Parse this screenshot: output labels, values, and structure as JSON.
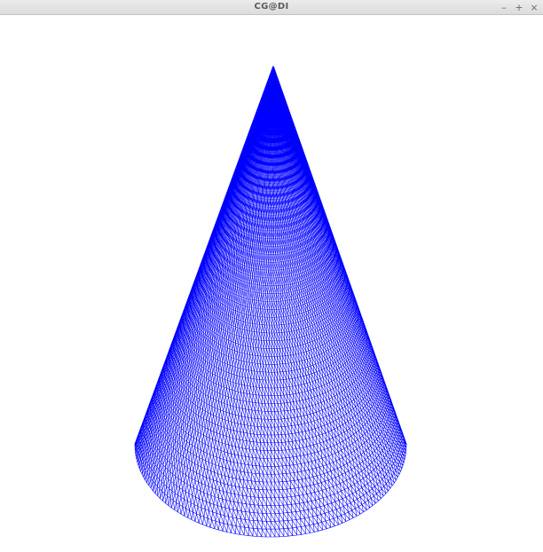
{
  "window": {
    "title": "CG@DI",
    "controls": {
      "minimize_label": "–",
      "maximize_label": "+",
      "close_label": "×"
    }
  },
  "render": {
    "object": "cone",
    "style": "wireframe",
    "mesh_color": "#0000ff",
    "background_color": "#ffffff"
  }
}
